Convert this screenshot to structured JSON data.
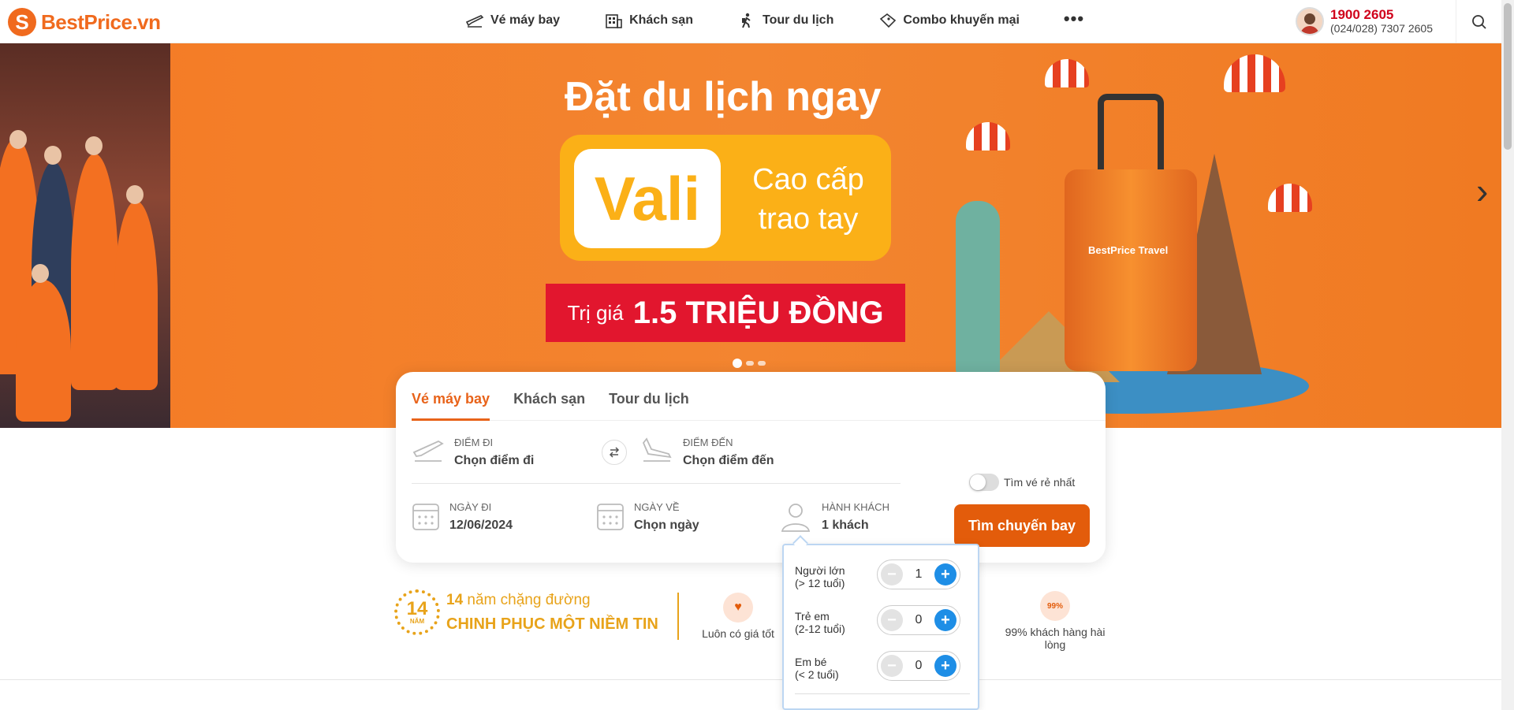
{
  "header": {
    "logo_text": "BestPrice.vn",
    "nav": [
      {
        "label": "Vé máy bay",
        "icon": "plane-icon"
      },
      {
        "label": "Khách sạn",
        "icon": "hotel-icon"
      },
      {
        "label": "Tour du lịch",
        "icon": "hiker-icon"
      },
      {
        "label": "Combo khuyến mại",
        "icon": "ticket-icon"
      }
    ],
    "more_label": "•••",
    "hotline": "1900 2605",
    "hotline_sub": "(024/028) 7307 2605"
  },
  "banner": {
    "headline": "Đặt du lịch ngay",
    "vali": "Vali",
    "vali_line1": "Cao cấp",
    "vali_line2": "trao tay",
    "price_prefix": "Trị giá",
    "price_value": "1.5 TRIỆU ĐỒNG",
    "suitcase_label": "BestPrice Travel",
    "next_arrow": "›",
    "slides": 3,
    "active_slide": 1
  },
  "booking": {
    "tabs": [
      "Vé máy bay",
      "Khách sạn",
      "Tour du lịch"
    ],
    "active_tab": 0,
    "from_label": "Điểm đi",
    "from_value": "Chọn điểm đi",
    "to_label": "Điểm đến",
    "to_value": "Chọn điểm đến",
    "depart_label": "Ngày đi",
    "depart_value": "12/06/2024",
    "return_label": "Ngày về",
    "return_value": "Chọn ngày",
    "pax_label": "Hành khách",
    "pax_value": "1 khách",
    "cheapest_label": "Tìm vé rẻ nhất",
    "cheapest_on": false,
    "search_label": "Tìm chuyến bay"
  },
  "passengers": [
    {
      "label_line1": "Người lớn",
      "label_line2": "(> 12 tuổi)",
      "count": "1"
    },
    {
      "label_line1": "Trẻ em",
      "label_line2": "(2-12 tuổi)",
      "count": "0"
    },
    {
      "label_line1": "Em bé",
      "label_line2": "(< 2 tuổi)",
      "count": "0"
    }
  ],
  "trust": {
    "years_num": "14",
    "years_badge": "NĂM",
    "years_line1_num": "14",
    "years_line1": "năm chặng đường",
    "years_line2": "CHINH PHỤC MỘT NIỀM TIN",
    "best_price": "Luôn có giá tốt",
    "satisfaction_badge": "99%",
    "satisfaction_line1": "99% khách hàng hài",
    "satisfaction_line2": "lòng"
  },
  "colors": {
    "brand_orange": "#e8631a",
    "hotline_red": "#d0021b",
    "plus_blue": "#1e8ee6",
    "gold": "#e8a31a"
  }
}
